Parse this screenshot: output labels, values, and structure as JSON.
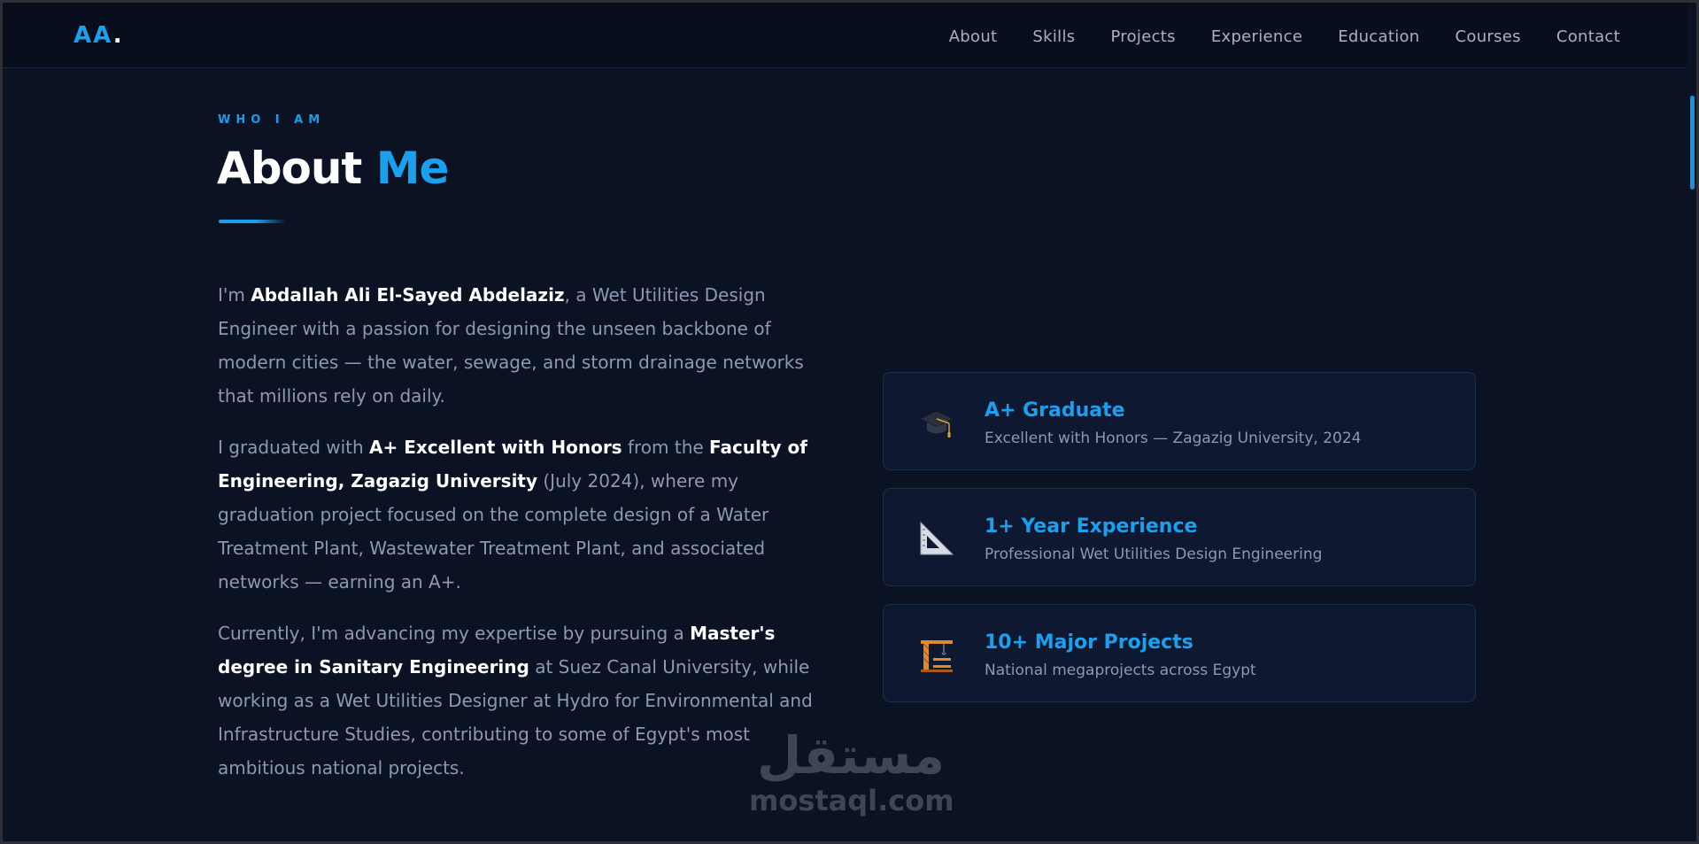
{
  "nav": {
    "logo_main": "AA",
    "logo_dot": ".",
    "links": [
      "About",
      "Skills",
      "Projects",
      "Experience",
      "Education",
      "Courses",
      "Contact"
    ]
  },
  "section": {
    "eyebrow": "WHO I AM",
    "title_main": "About ",
    "title_accent": "Me"
  },
  "bio": {
    "p1": [
      {
        "t": "I'm ",
        "b": false
      },
      {
        "t": "Abdallah Ali El-Sayed Abdelaziz",
        "b": true
      },
      {
        "t": ", a Wet Utilities Design Engineer with a passion for designing the unseen backbone of modern cities — the water, sewage, and storm drainage networks that millions rely on daily.",
        "b": false
      }
    ],
    "p2": [
      {
        "t": "I graduated with ",
        "b": false
      },
      {
        "t": "A+ Excellent with Honors",
        "b": true
      },
      {
        "t": " from the ",
        "b": false
      },
      {
        "t": "Faculty of Engineering, Zagazig University",
        "b": true
      },
      {
        "t": " (July 2024), where my graduation project focused on the complete design of a Water Treatment Plant, Wastewater Treatment Plant, and associated networks — earning an A+.",
        "b": false
      }
    ],
    "p3": [
      {
        "t": "Currently, I'm advancing my expertise by pursuing a ",
        "b": false
      },
      {
        "t": "Master's degree in Sanitary Engineering",
        "b": true
      },
      {
        "t": " at Suez Canal University, while working as a Wet Utilities Designer at Hydro for Environmental and Infrastructure Studies, contributing to some of Egypt's most ambitious national projects.",
        "b": false
      }
    ]
  },
  "cards": [
    {
      "icon": "graduation-cap-icon",
      "title": "A+ Graduate",
      "subtitle": "Excellent with Honors — Zagazig University, 2024"
    },
    {
      "icon": "triangle-ruler-icon",
      "title": "1+ Year Experience",
      "subtitle": "Professional Wet Utilities Design Engineering"
    },
    {
      "icon": "construction-crane-icon",
      "title": "10+ Major Projects",
      "subtitle": "National megaprojects across Egypt"
    }
  ],
  "watermark": {
    "arabic": "مستقل",
    "latin": "mostaql.com"
  },
  "colors": {
    "accent": "#1aa0ee",
    "background": "#0b1224",
    "card": "#0e1830",
    "muted_text": "#8c99b2"
  }
}
